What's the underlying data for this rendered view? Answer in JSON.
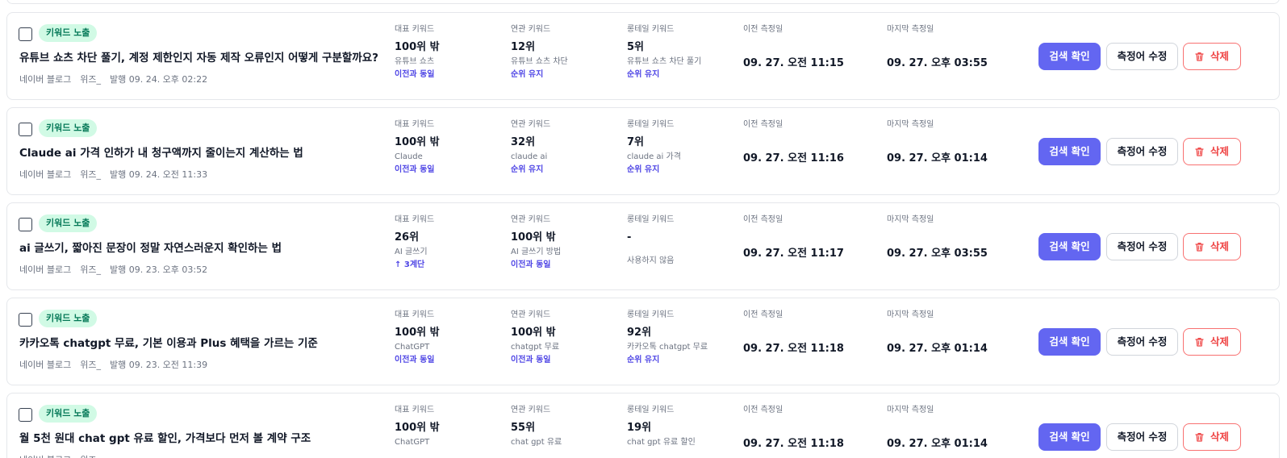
{
  "labels": {
    "badge": "키워드 노출",
    "main_kw": "대표 키워드",
    "related_kw": "연관 키워드",
    "longtail_kw": "롱테일 키워드",
    "prev_measure": "이전 측정일",
    "last_measure": "마지막 측정일",
    "search_button": "검색 확인",
    "edit_button": "측정어 수정",
    "delete_button": "삭제",
    "unused": "사용하지 않음"
  },
  "colors": {
    "primary": "#6366f1",
    "badge_bg": "#d1fae5",
    "badge_text": "#047857",
    "change_text": "#4f46e5",
    "danger": "#ef4444"
  },
  "rows": [
    {
      "title": "유튜브 쇼츠 차단 풀기, 계정 제한인지 자동 제작 오류인지 어떻게 구분할까요?",
      "source": "네이버 블로그",
      "author": "위즈_",
      "published": "발행 09. 24. 오후 02:22",
      "main": {
        "rank": "100위 밖",
        "term": "유튜브 쇼츠",
        "change": "이전과 동일"
      },
      "related": {
        "rank": "12위",
        "term": "유튜브 쇼츠 차단",
        "change": "순위 유지"
      },
      "longtail": {
        "rank": "5위",
        "term": "유튜브 쇼츠 차단 풀기",
        "change": "순위 유지"
      },
      "prev": "09. 27. 오전 11:15",
      "last": "09. 27. 오후 03:55"
    },
    {
      "title": "Claude ai 가격 인하가 내 청구액까지 줄이는지 계산하는 법",
      "source": "네이버 블로그",
      "author": "위즈_",
      "published": "발행 09. 24. 오전 11:33",
      "main": {
        "rank": "100위 밖",
        "term": "Claude",
        "change": "이전과 동일"
      },
      "related": {
        "rank": "32위",
        "term": "claude ai",
        "change": "순위 유지"
      },
      "longtail": {
        "rank": "7위",
        "term": "claude ai 가격",
        "change": "순위 유지"
      },
      "prev": "09. 27. 오전 11:16",
      "last": "09. 27. 오후 01:14"
    },
    {
      "title": "ai 글쓰기, 짧아진 문장이 정말 자연스러운지 확인하는 법",
      "source": "네이버 블로그",
      "author": "위즈_",
      "published": "발행 09. 23. 오후 03:52",
      "main": {
        "rank": "26위",
        "term": "AI 글쓰기",
        "change": "↑ 3계단"
      },
      "related": {
        "rank": "100위 밖",
        "term": "AI 글쓰기 방법",
        "change": "이전과 동일"
      },
      "longtail": {
        "rank": "-",
        "term": "",
        "change": "",
        "unused": true
      },
      "prev": "09. 27. 오전 11:17",
      "last": "09. 27. 오후 03:55"
    },
    {
      "title": "카카오톡 chatgpt 무료, 기본 이용과 Plus 혜택을 가르는 기준",
      "source": "네이버 블로그",
      "author": "위즈_",
      "published": "발행 09. 23. 오전 11:39",
      "main": {
        "rank": "100위 밖",
        "term": "ChatGPT",
        "change": "이전과 동일"
      },
      "related": {
        "rank": "100위 밖",
        "term": "chatgpt 무료",
        "change": "이전과 동일"
      },
      "longtail": {
        "rank": "92위",
        "term": "카카오톡 chatgpt 무료",
        "change": "순위 유지"
      },
      "prev": "09. 27. 오전 11:18",
      "last": "09. 27. 오후 01:14"
    },
    {
      "title": "월 5천 원대 chat gpt 유료 할인, 가격보다 먼저 볼 계약 구조",
      "source": "네이버 블로그",
      "author": "위즈_",
      "published": "",
      "main": {
        "rank": "100위 밖",
        "term": "ChatGPT",
        "change": ""
      },
      "related": {
        "rank": "55위",
        "term": "chat gpt 유료",
        "change": ""
      },
      "longtail": {
        "rank": "19위",
        "term": "chat gpt 유료 할인",
        "change": ""
      },
      "prev": "09. 27. 오전 11:18",
      "last": "09. 27. 오후 01:14"
    }
  ]
}
